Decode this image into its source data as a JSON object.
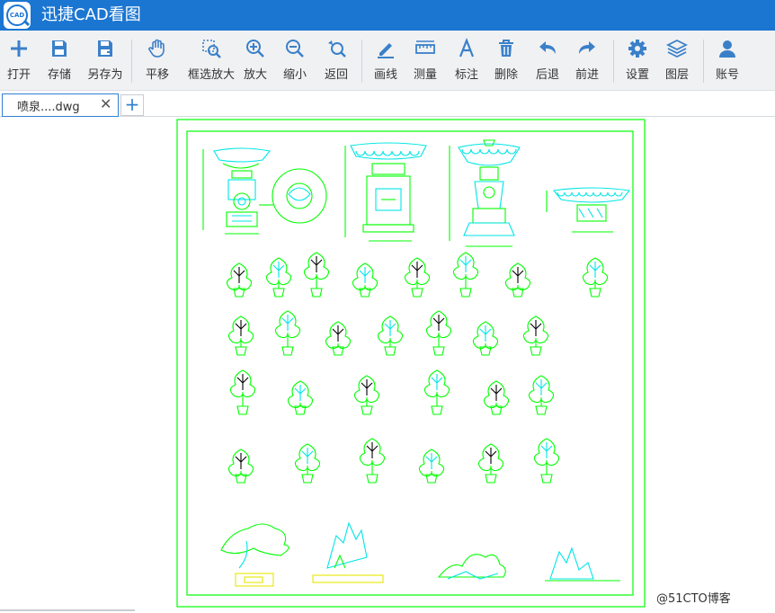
{
  "app": {
    "title": "迅捷CAD看图",
    "logo_text": "CAD"
  },
  "toolbar": {
    "open": "打开",
    "save": "存储",
    "save_as": "另存为",
    "pan": "平移",
    "box_zoom": "框选放大",
    "zoom_in": "放大",
    "zoom_out": "缩小",
    "back": "返回",
    "draw_line": "画线",
    "measure": "测量",
    "annotate": "标注",
    "delete": "删除",
    "undo": "后退",
    "redo": "前进",
    "settings": "设置",
    "layers": "图层",
    "account": "账号"
  },
  "tabs": {
    "active_file": "喷泉....dwg",
    "close_glyph": "✕",
    "add_glyph": "+"
  },
  "watermark": "@51CTO博客",
  "colors": {
    "titlebar": "#1b76d2",
    "toolbar_icon": "#3a80c9",
    "drawing_green": "#00ff00",
    "drawing_cyan": "#00e5e5"
  }
}
